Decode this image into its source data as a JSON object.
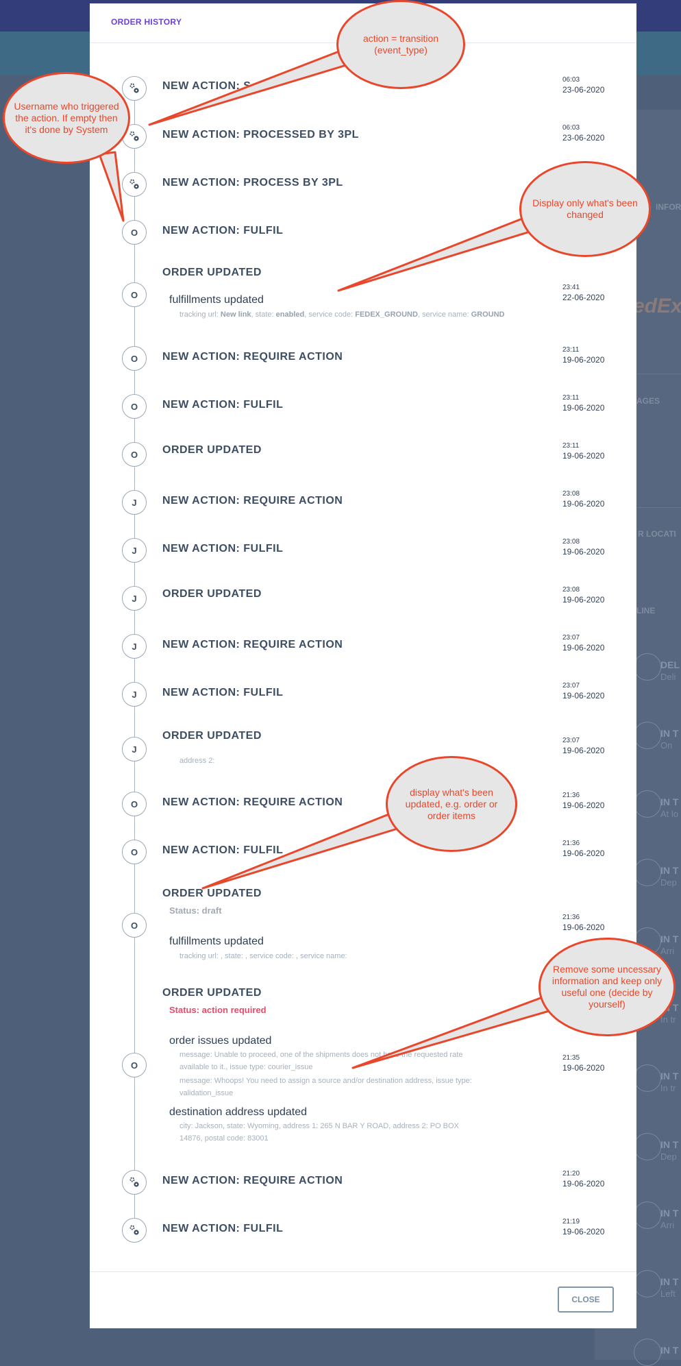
{
  "modal": {
    "title": "ORDER HISTORY",
    "close_label": "CLOSE"
  },
  "background_fragments": {
    "info": "INFOR",
    "brand": "edEx",
    "packages": "AGES",
    "locations": "R LOCATI",
    "line": "LINE",
    "track_events": [
      {
        "head": "DEL",
        "sub": "Deli"
      },
      {
        "head": "IN T",
        "sub": "On"
      },
      {
        "head": "IN T",
        "sub": "At lo"
      },
      {
        "head": "IN T",
        "sub": "Dep"
      },
      {
        "head": "IN T",
        "sub": "Arri"
      },
      {
        "head": "IN T",
        "sub": "In tr"
      },
      {
        "head": "IN T",
        "sub": "In tr"
      },
      {
        "head": "IN T",
        "sub": "Dep"
      },
      {
        "head": "IN T",
        "sub": "Arri"
      },
      {
        "head": "IN T",
        "sub": "Left"
      },
      {
        "head": "IN T",
        "sub": ""
      }
    ]
  },
  "events": [
    {
      "icon": "gear",
      "title": "NEW ACTION: S",
      "time": "06:03",
      "date": "23-06-2020"
    },
    {
      "icon": "gear",
      "title": "NEW ACTION: PROCESSED BY 3PL",
      "time": "06:03",
      "date": "23-06-2020"
    },
    {
      "icon": "gear",
      "title": "NEW ACTION: PROCESS BY 3PL"
    },
    {
      "icon": "O",
      "title": "NEW ACTION: FULFIL"
    },
    {
      "icon": "O",
      "title": "ORDER UPDATED",
      "time": "23:41",
      "date": "22-06-2020",
      "sub": "fulfillments updated",
      "details": [
        {
          "k": "tracking url:",
          "v": "New link"
        },
        {
          "k": "state:",
          "v": "enabled"
        },
        {
          "k": "service code:",
          "v": "FEDEX_GROUND"
        },
        {
          "k": "service name:",
          "v": "GROUND"
        }
      ]
    },
    {
      "icon": "O",
      "title": "NEW ACTION: REQUIRE ACTION",
      "time": "23:11",
      "date": "19-06-2020"
    },
    {
      "icon": "O",
      "title": "NEW ACTION: FULFIL",
      "time": "23:11",
      "date": "19-06-2020"
    },
    {
      "icon": "O",
      "title": "ORDER UPDATED",
      "time": "23:11",
      "date": "19-06-2020"
    },
    {
      "icon": "J",
      "title": "NEW ACTION: REQUIRE ACTION",
      "time": "23:08",
      "date": "19-06-2020"
    },
    {
      "icon": "J",
      "title": "NEW ACTION: FULFIL",
      "time": "23:08",
      "date": "19-06-2020"
    },
    {
      "icon": "J",
      "title": "ORDER UPDATED",
      "time": "23:08",
      "date": "19-06-2020"
    },
    {
      "icon": "J",
      "title": "NEW ACTION: REQUIRE ACTION",
      "time": "23:07",
      "date": "19-06-2020"
    },
    {
      "icon": "J",
      "title": "NEW ACTION: FULFIL",
      "time": "23:07",
      "date": "19-06-2020"
    },
    {
      "icon": "J",
      "title": "ORDER UPDATED",
      "time": "23:07",
      "date": "19-06-2020",
      "detail_text": "address 2:"
    },
    {
      "icon": "O",
      "title": "NEW ACTION: REQUIRE ACTION",
      "time": "21:36",
      "date": "19-06-2020"
    },
    {
      "icon": "O",
      "title": "NEW ACTION: FULFIL",
      "time": "21:36",
      "date": "19-06-2020"
    },
    {
      "icon": "O",
      "title": "ORDER UPDATED",
      "time": "21:36",
      "date": "19-06-2020",
      "status": "Status: draft",
      "status_color": "#a3a9b2",
      "sub": "fulfillments updated",
      "details": [
        {
          "k": "tracking url:",
          "v": ""
        },
        {
          "k": "state:",
          "v": ""
        },
        {
          "k": "service code:",
          "v": ""
        },
        {
          "k": "service name:",
          "v": ""
        }
      ]
    },
    {
      "icon": "O",
      "title": "ORDER UPDATED",
      "time": "21:35",
      "date": "19-06-2020",
      "status": "Status: action required",
      "status_color": "#e84a6a",
      "issues_title": "order issues updated",
      "issue1_line1": "message:  Unable to proceed, one of the shipments does not have the requested rate",
      "issue1_line2": "available to it.,  issue type:  courier_issue",
      "issue2_line1": "message:  Whoops! You need to assign a source and/or destination address,  issue type:",
      "issue2_line2": "validation_issue",
      "address_title": "destination address updated",
      "address_line1": "city:  Jackson,  state:  Wyoming,  address 1:  265 N BAR Y ROAD,  address 2:  PO BOX",
      "address_line2": "14876,  postal code:  83001"
    },
    {
      "icon": "gear",
      "title": "NEW ACTION: REQUIRE ACTION",
      "time": "21:20",
      "date": "19-06-2020"
    },
    {
      "icon": "gear",
      "title": "NEW ACTION: FULFIL",
      "time": "21:19",
      "date": "19-06-2020"
    }
  ],
  "annotations": [
    {
      "id": "action",
      "text": "action = transition (event_type)"
    },
    {
      "id": "username",
      "text": "Username who triggered the action. If empty then it's done by System"
    },
    {
      "id": "changed",
      "text": "Display only what's been changed"
    },
    {
      "id": "updated",
      "text": "display what's been updated, e.g. order or order items"
    },
    {
      "id": "remove",
      "text": "Remove some uncessary information and keep only useful one (decide by yourself)"
    }
  ],
  "colors": {
    "accent": "#6a3fe0",
    "callout_border": "#e8472b",
    "status_required": "#e84a6a",
    "overlay": "#4d5f79"
  }
}
